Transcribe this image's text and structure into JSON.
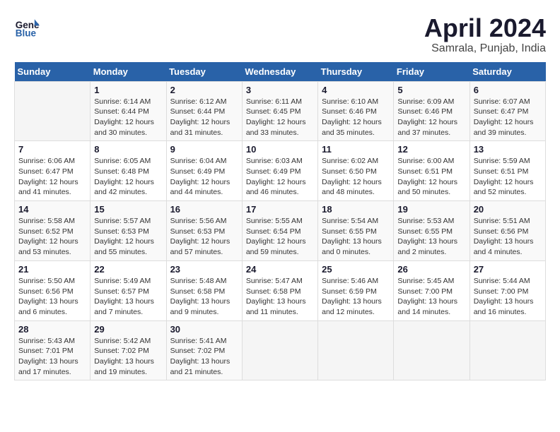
{
  "header": {
    "logo_line1": "General",
    "logo_line2": "Blue",
    "title": "April 2024",
    "subtitle": "Samrala, Punjab, India"
  },
  "calendar": {
    "days_of_week": [
      "Sunday",
      "Monday",
      "Tuesday",
      "Wednesday",
      "Thursday",
      "Friday",
      "Saturday"
    ],
    "weeks": [
      [
        {
          "day": "",
          "info": ""
        },
        {
          "day": "1",
          "info": "Sunrise: 6:14 AM\nSunset: 6:44 PM\nDaylight: 12 hours and 30 minutes."
        },
        {
          "day": "2",
          "info": "Sunrise: 6:12 AM\nSunset: 6:44 PM\nDaylight: 12 hours and 31 minutes."
        },
        {
          "day": "3",
          "info": "Sunrise: 6:11 AM\nSunset: 6:45 PM\nDaylight: 12 hours and 33 minutes."
        },
        {
          "day": "4",
          "info": "Sunrise: 6:10 AM\nSunset: 6:46 PM\nDaylight: 12 hours and 35 minutes."
        },
        {
          "day": "5",
          "info": "Sunrise: 6:09 AM\nSunset: 6:46 PM\nDaylight: 12 hours and 37 minutes."
        },
        {
          "day": "6",
          "info": "Sunrise: 6:07 AM\nSunset: 6:47 PM\nDaylight: 12 hours and 39 minutes."
        }
      ],
      [
        {
          "day": "7",
          "info": "Sunrise: 6:06 AM\nSunset: 6:47 PM\nDaylight: 12 hours and 41 minutes."
        },
        {
          "day": "8",
          "info": "Sunrise: 6:05 AM\nSunset: 6:48 PM\nDaylight: 12 hours and 42 minutes."
        },
        {
          "day": "9",
          "info": "Sunrise: 6:04 AM\nSunset: 6:49 PM\nDaylight: 12 hours and 44 minutes."
        },
        {
          "day": "10",
          "info": "Sunrise: 6:03 AM\nSunset: 6:49 PM\nDaylight: 12 hours and 46 minutes."
        },
        {
          "day": "11",
          "info": "Sunrise: 6:02 AM\nSunset: 6:50 PM\nDaylight: 12 hours and 48 minutes."
        },
        {
          "day": "12",
          "info": "Sunrise: 6:00 AM\nSunset: 6:51 PM\nDaylight: 12 hours and 50 minutes."
        },
        {
          "day": "13",
          "info": "Sunrise: 5:59 AM\nSunset: 6:51 PM\nDaylight: 12 hours and 52 minutes."
        }
      ],
      [
        {
          "day": "14",
          "info": "Sunrise: 5:58 AM\nSunset: 6:52 PM\nDaylight: 12 hours and 53 minutes."
        },
        {
          "day": "15",
          "info": "Sunrise: 5:57 AM\nSunset: 6:53 PM\nDaylight: 12 hours and 55 minutes."
        },
        {
          "day": "16",
          "info": "Sunrise: 5:56 AM\nSunset: 6:53 PM\nDaylight: 12 hours and 57 minutes."
        },
        {
          "day": "17",
          "info": "Sunrise: 5:55 AM\nSunset: 6:54 PM\nDaylight: 12 hours and 59 minutes."
        },
        {
          "day": "18",
          "info": "Sunrise: 5:54 AM\nSunset: 6:55 PM\nDaylight: 13 hours and 0 minutes."
        },
        {
          "day": "19",
          "info": "Sunrise: 5:53 AM\nSunset: 6:55 PM\nDaylight: 13 hours and 2 minutes."
        },
        {
          "day": "20",
          "info": "Sunrise: 5:51 AM\nSunset: 6:56 PM\nDaylight: 13 hours and 4 minutes."
        }
      ],
      [
        {
          "day": "21",
          "info": "Sunrise: 5:50 AM\nSunset: 6:56 PM\nDaylight: 13 hours and 6 minutes."
        },
        {
          "day": "22",
          "info": "Sunrise: 5:49 AM\nSunset: 6:57 PM\nDaylight: 13 hours and 7 minutes."
        },
        {
          "day": "23",
          "info": "Sunrise: 5:48 AM\nSunset: 6:58 PM\nDaylight: 13 hours and 9 minutes."
        },
        {
          "day": "24",
          "info": "Sunrise: 5:47 AM\nSunset: 6:58 PM\nDaylight: 13 hours and 11 minutes."
        },
        {
          "day": "25",
          "info": "Sunrise: 5:46 AM\nSunset: 6:59 PM\nDaylight: 13 hours and 12 minutes."
        },
        {
          "day": "26",
          "info": "Sunrise: 5:45 AM\nSunset: 7:00 PM\nDaylight: 13 hours and 14 minutes."
        },
        {
          "day": "27",
          "info": "Sunrise: 5:44 AM\nSunset: 7:00 PM\nDaylight: 13 hours and 16 minutes."
        }
      ],
      [
        {
          "day": "28",
          "info": "Sunrise: 5:43 AM\nSunset: 7:01 PM\nDaylight: 13 hours and 17 minutes."
        },
        {
          "day": "29",
          "info": "Sunrise: 5:42 AM\nSunset: 7:02 PM\nDaylight: 13 hours and 19 minutes."
        },
        {
          "day": "30",
          "info": "Sunrise: 5:41 AM\nSunset: 7:02 PM\nDaylight: 13 hours and 21 minutes."
        },
        {
          "day": "",
          "info": ""
        },
        {
          "day": "",
          "info": ""
        },
        {
          "day": "",
          "info": ""
        },
        {
          "day": "",
          "info": ""
        }
      ]
    ]
  }
}
